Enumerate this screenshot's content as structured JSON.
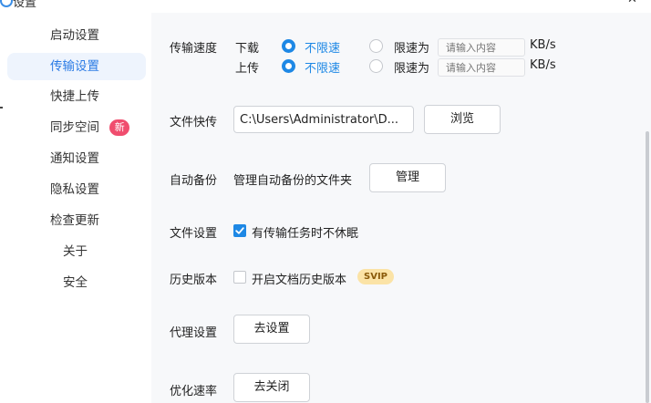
{
  "window": {
    "title": "设置",
    "close_glyph": "✕"
  },
  "sidebar": {
    "items": [
      {
        "label": "启动设置"
      },
      {
        "label": "传输设置"
      },
      {
        "label": "快捷上传"
      },
      {
        "label": "同步空间",
        "badge": "新"
      },
      {
        "label": "通知设置"
      },
      {
        "label": "隐私设置"
      },
      {
        "label": "检查更新"
      },
      {
        "label": "关于"
      },
      {
        "label": "安全"
      }
    ]
  },
  "transfer_speed": {
    "label": "传输速度",
    "download_label": "下载",
    "upload_label": "上传",
    "unlimited_label": "不限速",
    "limit_label": "限速为",
    "placeholder": "请输入内容",
    "unit": "KB/s",
    "download_mode": "unlimited",
    "upload_mode": "unlimited"
  },
  "file_quick_transfer": {
    "label": "文件快传",
    "path_value": "C:\\Users\\Administrator\\D...",
    "browse_label": "浏览"
  },
  "auto_backup": {
    "label": "自动备份",
    "desc": "管理自动备份的文件夹",
    "manage_label": "管理"
  },
  "file_settings": {
    "label": "文件设置",
    "no_sleep_label": "有传输任务时不休眠",
    "no_sleep_checked": true
  },
  "history_version": {
    "label": "历史版本",
    "enable_label": "开启文档历史版本",
    "enable_checked": false,
    "badge": "SVIP"
  },
  "proxy_settings": {
    "label": "代理设置",
    "button_label": "去设置"
  },
  "optimize_speed": {
    "label": "优化速率",
    "button_label": "去关闭"
  },
  "colors": {
    "accent": "#1e88e5",
    "sidebar_active_bg": "#eef4fd",
    "panel_bg": "#f7f8fa",
    "badge_new": "#f04d6e",
    "svip_bg": "#fbe3a6"
  }
}
